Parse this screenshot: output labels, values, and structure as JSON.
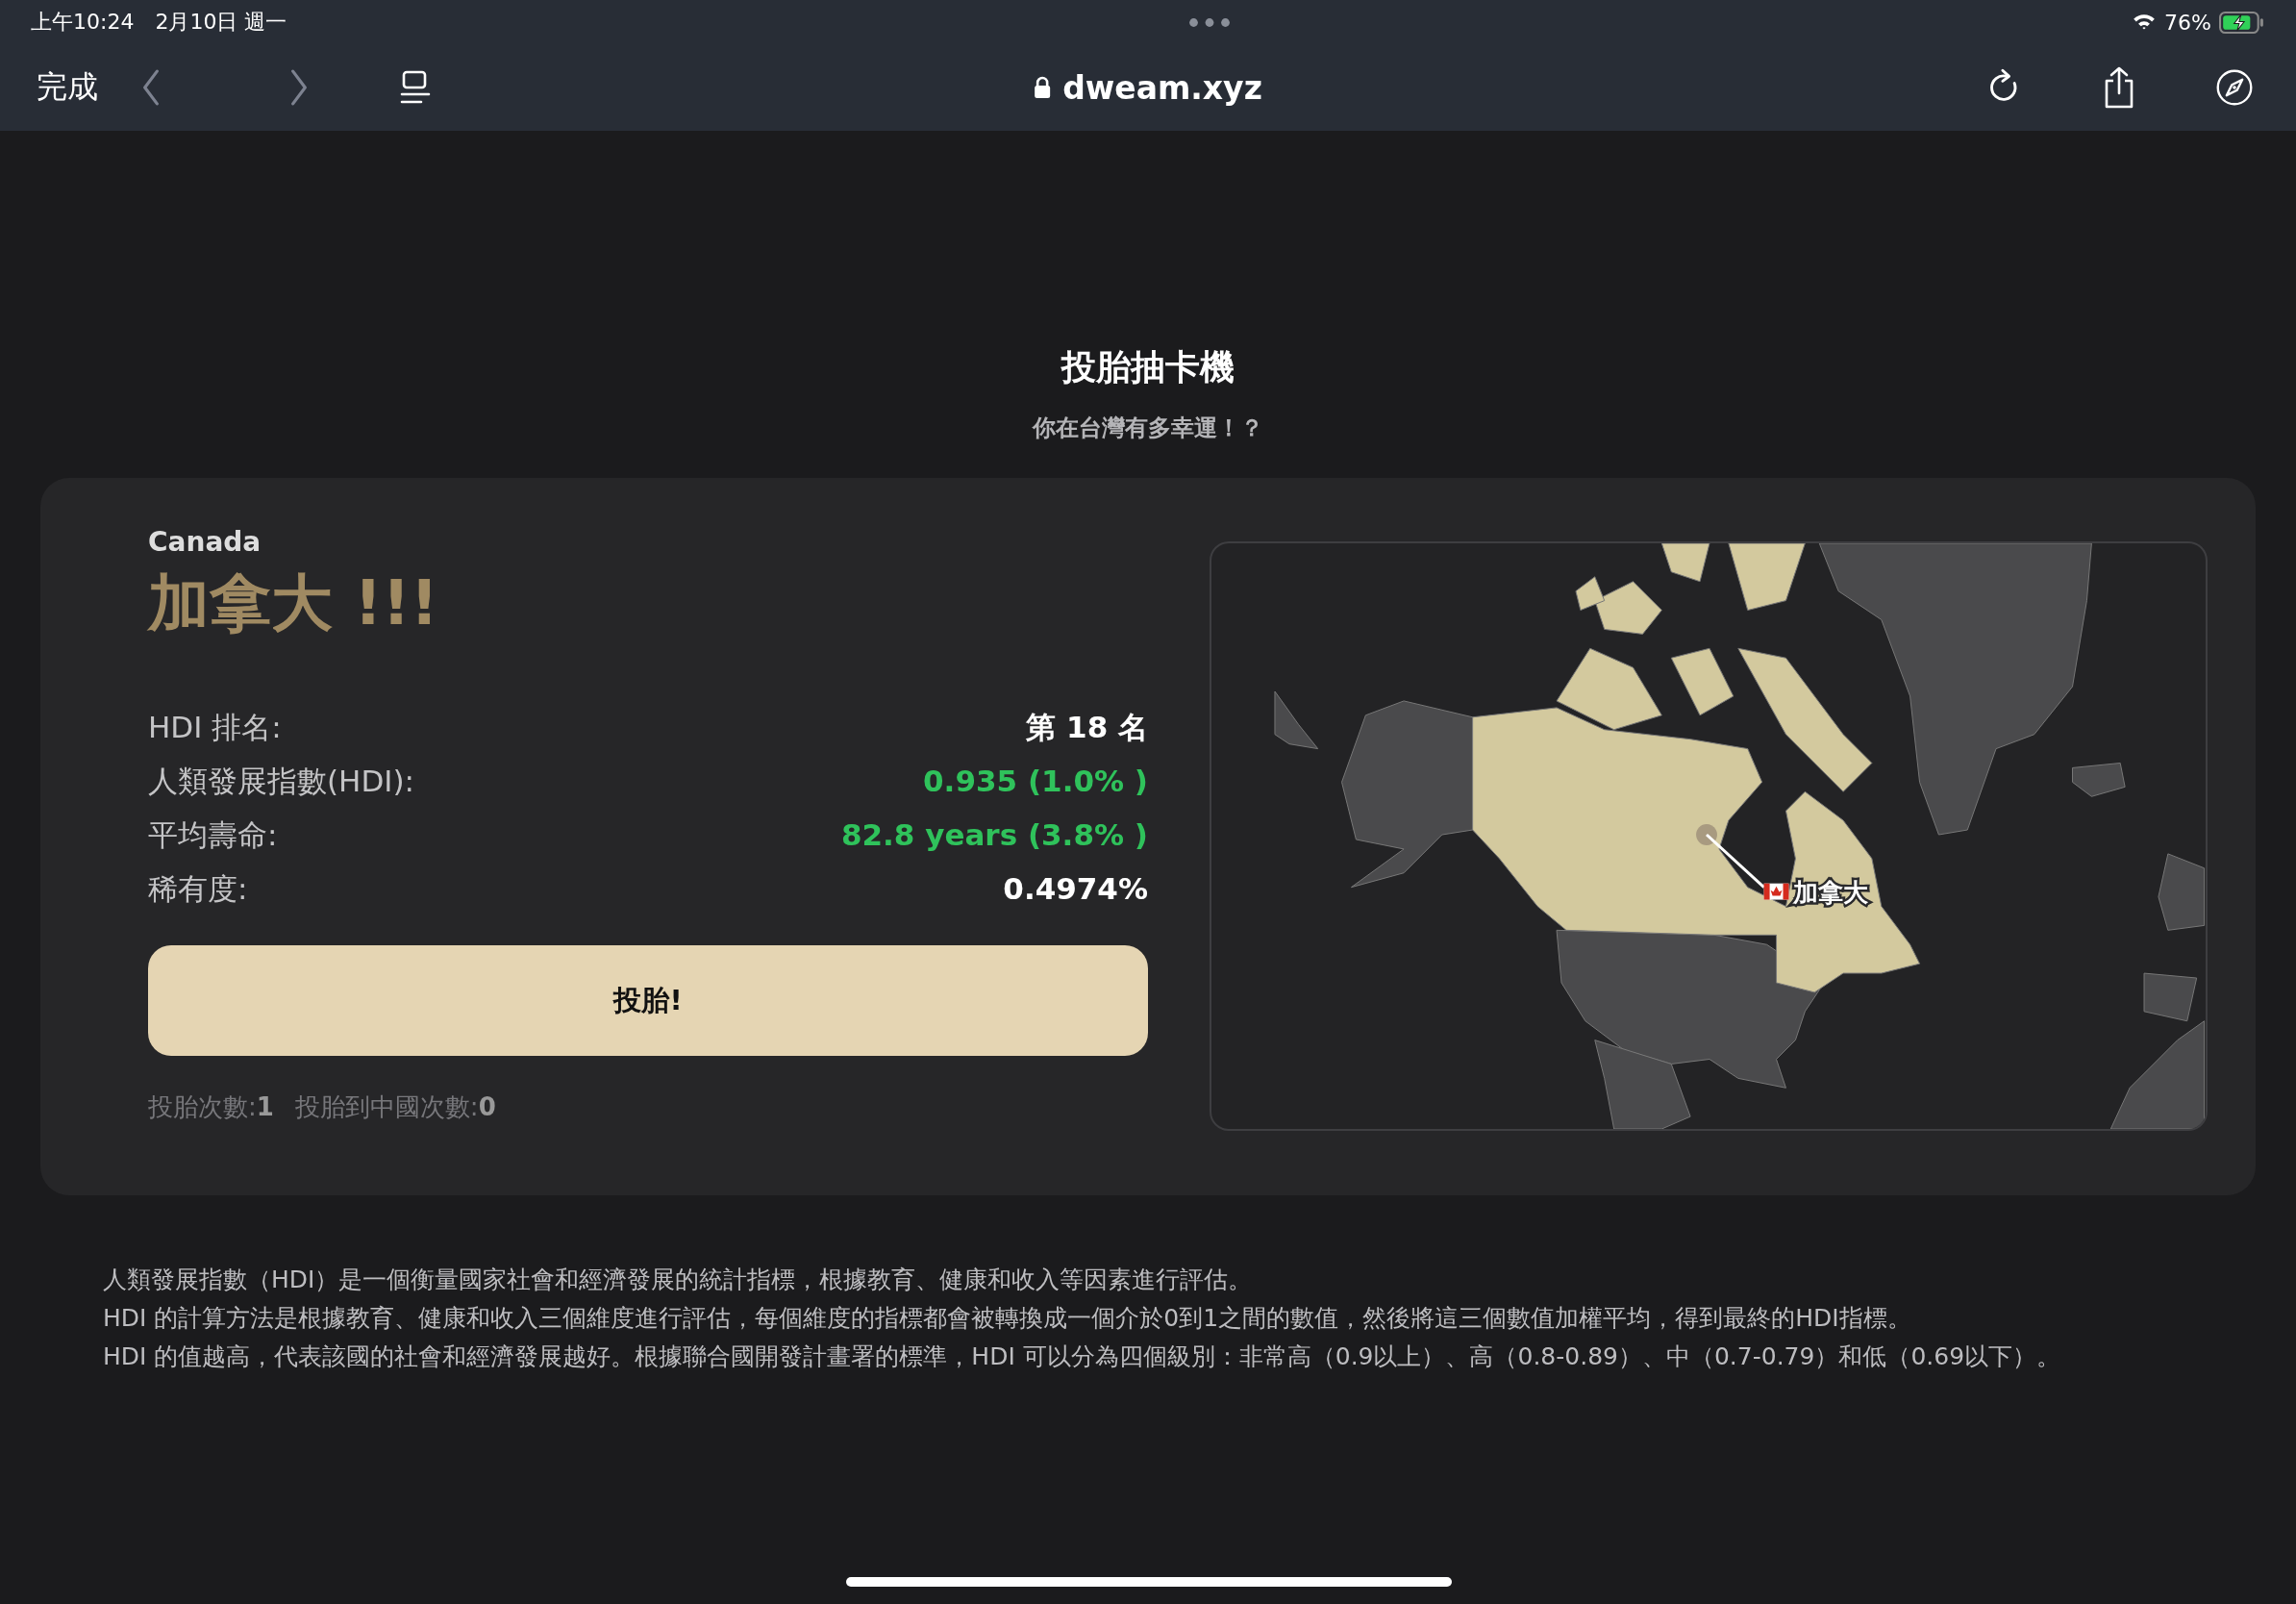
{
  "status_bar": {
    "time": "上午10:24",
    "date": "2月10日 週一",
    "battery": "76%"
  },
  "browser": {
    "done": "完成",
    "url": "dweam.xyz"
  },
  "header": {
    "title": "投胎抽卡機",
    "subtitle": "你在台灣有多幸運！？"
  },
  "result": {
    "country_en": "Canada",
    "country_zh": "加拿大 !!!",
    "stats": [
      {
        "label": "HDI 排名:",
        "value": "第 18 名",
        "kind": "plain"
      },
      {
        "label": "人類發展指數(HDI):",
        "value": "0.935 (1.0% )",
        "kind": "positive"
      },
      {
        "label": "平均壽命:",
        "value": "82.8 years (3.8% )",
        "kind": "positive"
      },
      {
        "label": "稀有度:",
        "value": "0.4974%",
        "kind": "plain"
      }
    ],
    "button": "投胎!",
    "counters": [
      "投胎次數:**1**",
      "投胎到中國次數:**0**"
    ]
  },
  "map": {
    "label": "加拿大"
  },
  "description": [
    "人類發展指數（HDI）是一個衡量國家社會和經濟發展的統計指標，根據教育、健康和收入等因素進行評估。",
    "HDI 的計算方法是根據教育、健康和收入三個維度進行評估，每個維度的指標都會被轉換成一個介於0到1之間的數值，然後將這三個數值加權平均，得到最終的HDI指標。",
    "HDI 的值越高，代表該國的社會和經濟發展越好。根據聯合國開發計畫署的標準，HDI 可以分為四個級別：非常高（0.9以上）、高（0.8-0.89）、中（0.7-0.79）和低（0.69以下）。"
  ]
}
